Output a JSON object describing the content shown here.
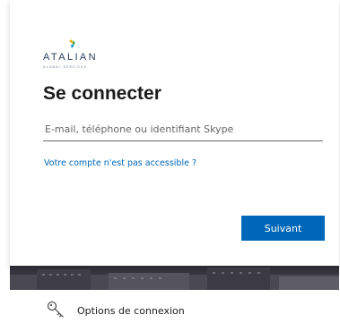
{
  "brand": {
    "name": "ATALIAN",
    "tagline": "GLOBAL SERVICES"
  },
  "signin": {
    "title": "Se connecter",
    "email_placeholder": "E-mail, téléphone ou identifiant Skype",
    "email_value": "",
    "cant_access_link": "Votre compte n'est pas accessible ?",
    "next_button": "Suivant"
  },
  "options": {
    "label": "Options de connexion",
    "icon": "key-icon"
  },
  "colors": {
    "accent": "#0067b8",
    "text": "#1b1b1b",
    "logo_text": "#2a3d5c"
  }
}
